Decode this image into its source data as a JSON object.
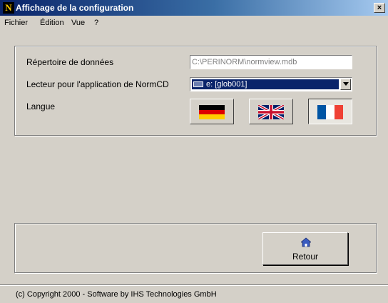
{
  "window": {
    "title": "Affichage de la configuration",
    "app_icon_letter": "N",
    "close_glyph": "×"
  },
  "menu": [
    {
      "label": "Fichier"
    },
    {
      "label": "Édition"
    },
    {
      "label": "Vue"
    },
    {
      "label": "?"
    }
  ],
  "settings": {
    "data_dir_label": "Répertoire de données",
    "data_dir_value": "C:\\PERINORM\\normview.mdb",
    "reader_label": "Lecteur pour l'application de NormCD",
    "reader_value": "e: [glob001]",
    "language_label": "Langue",
    "languages": [
      {
        "name": "german-flag-button",
        "selected": false
      },
      {
        "name": "english-flag-button",
        "selected": false
      },
      {
        "name": "french-flag-button",
        "selected": true
      }
    ]
  },
  "actions": {
    "back_label": "Retour",
    "back_icon": "home-icon"
  },
  "footer": {
    "copyright": "(c) Copyright 2000   -   Software by IHS Technologies GmbH"
  },
  "colors": {
    "title_gradient_start": "#0a246a",
    "title_gradient_end": "#a6caf0",
    "window_bg": "#d4d0c8",
    "selection": "#0a246a"
  }
}
